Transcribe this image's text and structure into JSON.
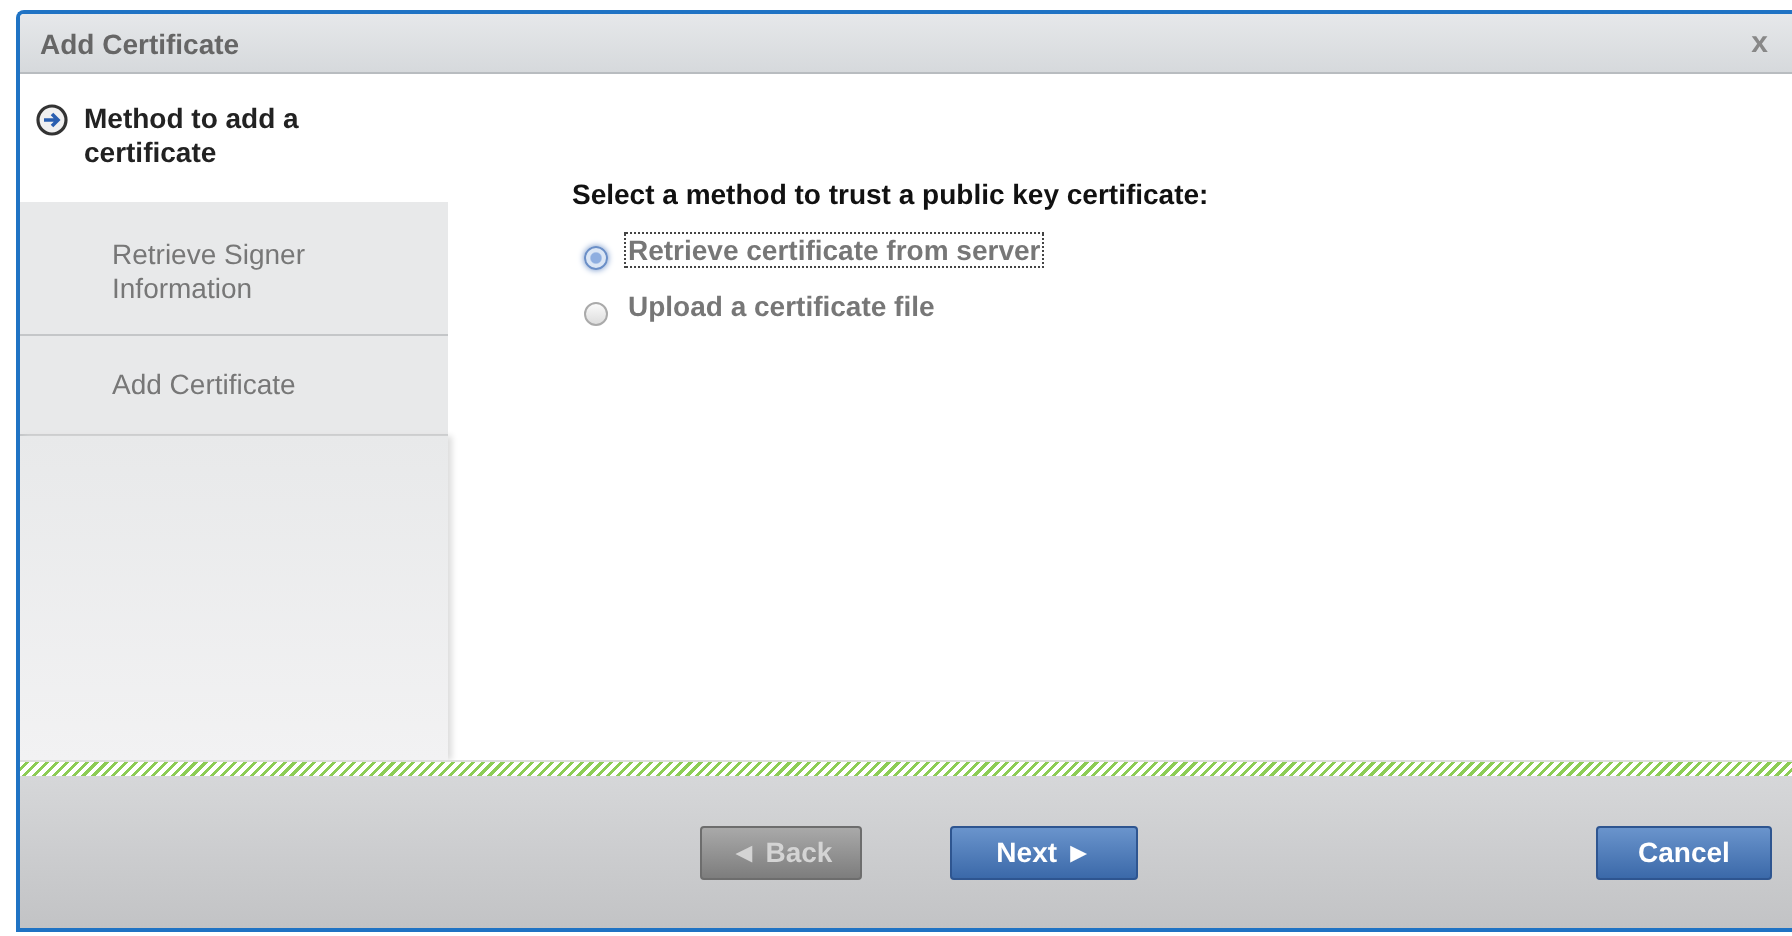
{
  "window": {
    "title": "Add Certificate",
    "close": "x"
  },
  "steps": [
    {
      "label": "Method to add a certificate",
      "selected": true
    },
    {
      "label": "Retrieve Signer Information",
      "selected": false
    },
    {
      "label": "Add Certificate",
      "selected": false
    }
  ],
  "prompt": "Select a method to trust a public key certificate:",
  "options": [
    {
      "label": "Retrieve certificate from server",
      "selected": true
    },
    {
      "label": "Upload a certificate file",
      "selected": false
    }
  ],
  "buttons": [
    {
      "label": "◄ Back",
      "disabled": true
    },
    {
      "label": "Next ►",
      "disabled": false
    },
    {
      "label": "Cancel",
      "disabled": false
    }
  ]
}
